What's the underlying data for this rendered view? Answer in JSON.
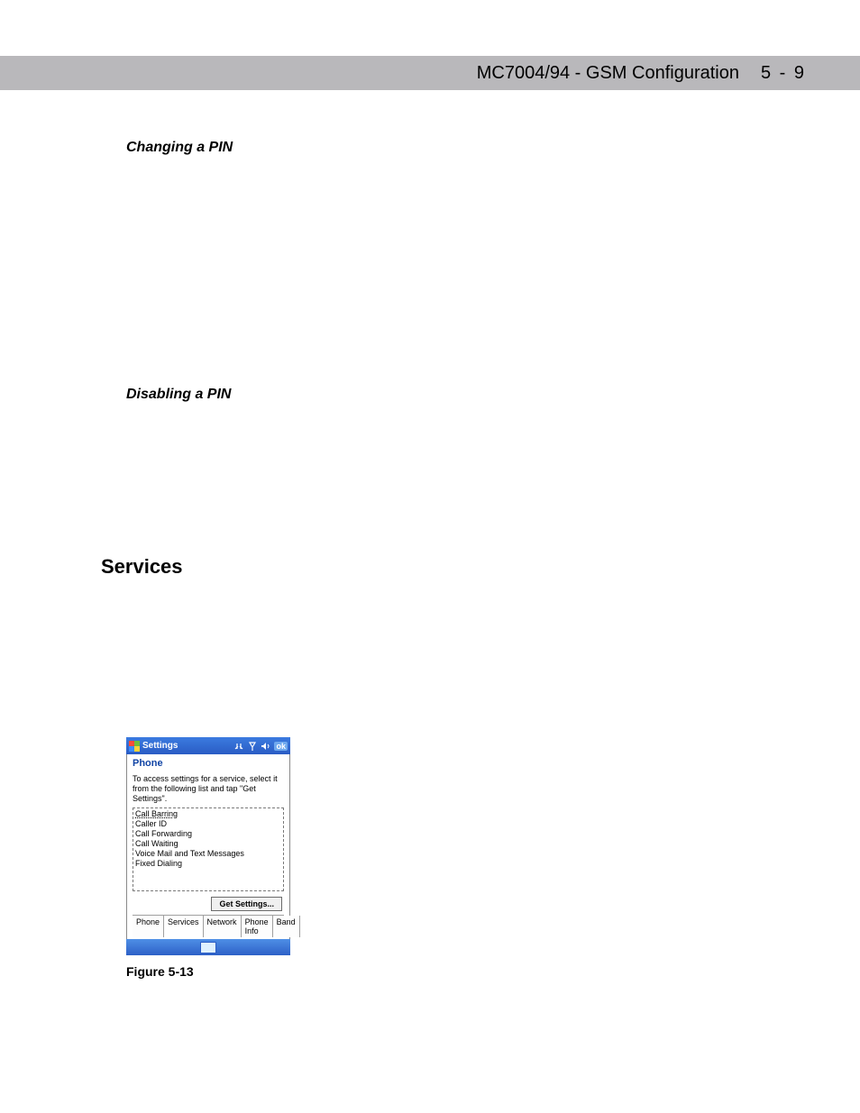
{
  "header": {
    "title": "MC7004/94 - GSM Configuration",
    "page": "5 - 9"
  },
  "sections": {
    "changing_pin": "Changing a PIN",
    "disabling_pin": "Disabling a PIN",
    "services": "Services"
  },
  "screenshot": {
    "titlebar": {
      "app": "Settings",
      "ok": "ok"
    },
    "pane_title": "Phone",
    "instruction": "To access settings for a service, select it from the following list and tap \"Get Settings\".",
    "services": [
      "Call Barring",
      "Caller ID",
      "Call Forwarding",
      "Call Waiting",
      "Voice Mail and Text Messages",
      "Fixed Dialing"
    ],
    "get_settings": "Get Settings...",
    "tabs": [
      "Phone",
      "Services",
      "Network",
      "Phone Info",
      "Band"
    ],
    "active_tab": 1
  },
  "figure_caption": "Figure 5-13"
}
